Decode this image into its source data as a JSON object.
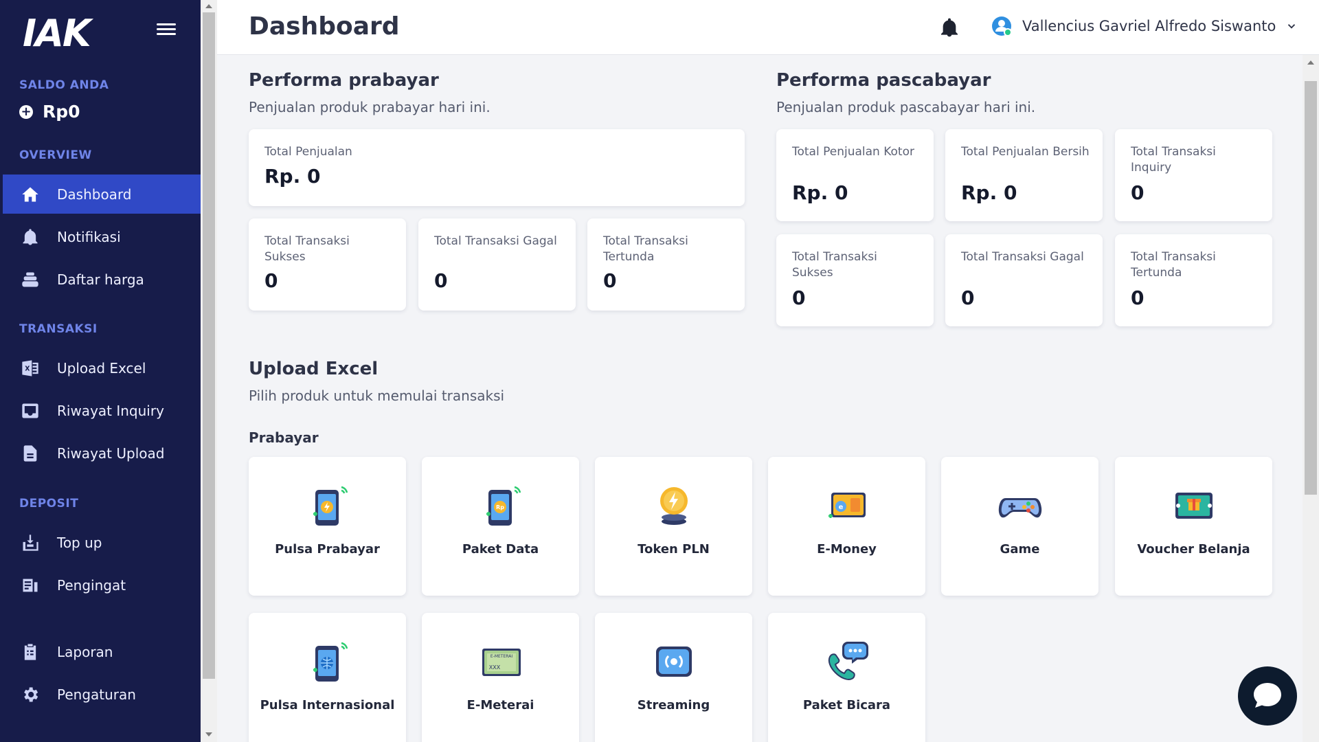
{
  "brand": {
    "logo_text": "IAK"
  },
  "sidebar": {
    "balance_label": "SALDO ANDA",
    "balance_value": "Rp0",
    "sections": {
      "overview": "OVERVIEW",
      "transaksi": "TRANSAKSI",
      "deposit": "DEPOSIT"
    },
    "items": [
      {
        "label": "Dashboard",
        "icon": "home-icon",
        "active": true
      },
      {
        "label": "Notifikasi",
        "icon": "bell-icon"
      },
      {
        "label": "Daftar harga",
        "icon": "stack-icon"
      },
      {
        "label": "Upload Excel",
        "icon": "excel-icon"
      },
      {
        "label": "Riwayat Inquiry",
        "icon": "inbox-icon"
      },
      {
        "label": "Riwayat Upload",
        "icon": "document-icon"
      },
      {
        "label": "Top up",
        "icon": "topup-icon"
      },
      {
        "label": "Pengingat",
        "icon": "reminder-icon"
      },
      {
        "label": "Laporan",
        "icon": "clipboard-icon"
      },
      {
        "label": "Pengaturan",
        "icon": "gear-icon"
      }
    ]
  },
  "header": {
    "title": "Dashboard",
    "user_name": "Vallencius Gavriel Alfredo Siswanto"
  },
  "prabayar_perf": {
    "title": "Performa prabayar",
    "subtitle": "Penjualan produk prabayar hari ini.",
    "total_penjualan": {
      "label": "Total Penjualan",
      "value": "Rp. 0"
    },
    "stats": [
      {
        "label": "Total Transaksi Sukses",
        "value": "0"
      },
      {
        "label": "Total Transaksi Gagal",
        "value": "0"
      },
      {
        "label": "Total Transaksi Tertunda",
        "value": "0"
      }
    ]
  },
  "pascabayar_perf": {
    "title": "Performa pascabayar",
    "subtitle": "Penjualan produk pascabayar hari ini.",
    "row1": [
      {
        "label": "Total Penjualan Kotor",
        "value": "Rp. 0"
      },
      {
        "label": "Total Penjualan Bersih",
        "value": "Rp. 0"
      },
      {
        "label": "Total Transaksi Inquiry",
        "value": "0"
      }
    ],
    "row2": [
      {
        "label": "Total Transaksi Sukses",
        "value": "0"
      },
      {
        "label": "Total Transaksi Gagal",
        "value": "0"
      },
      {
        "label": "Total Transaksi Tertunda",
        "value": "0"
      }
    ]
  },
  "upload": {
    "title": "Upload Excel",
    "subtitle": "Pilih produk untuk memulai transaksi",
    "group_label": "Prabayar",
    "products": [
      {
        "label": "Pulsa Prabayar",
        "icon": "phone-bolt-icon"
      },
      {
        "label": "Paket Data",
        "icon": "phone-rp-icon"
      },
      {
        "label": "Token PLN",
        "icon": "token-coin-icon"
      },
      {
        "label": "E-Money",
        "icon": "emoney-card-icon"
      },
      {
        "label": "Game",
        "icon": "gamepad-icon"
      },
      {
        "label": "Voucher Belanja",
        "icon": "voucher-gift-icon"
      },
      {
        "label": "Pulsa Internasional",
        "icon": "phone-globe-icon"
      },
      {
        "label": "E-Meterai",
        "icon": "emeterai-icon",
        "stamp_text": "E-METERAI",
        "stamp_code": "XXX"
      },
      {
        "label": "Streaming",
        "icon": "streaming-icon"
      },
      {
        "label": "Paket Bicara",
        "icon": "phone-chat-icon"
      }
    ]
  },
  "colors": {
    "sidebar_bg": "#171c4a",
    "active_item": "#3049c6",
    "section_label": "#6f84e8"
  }
}
